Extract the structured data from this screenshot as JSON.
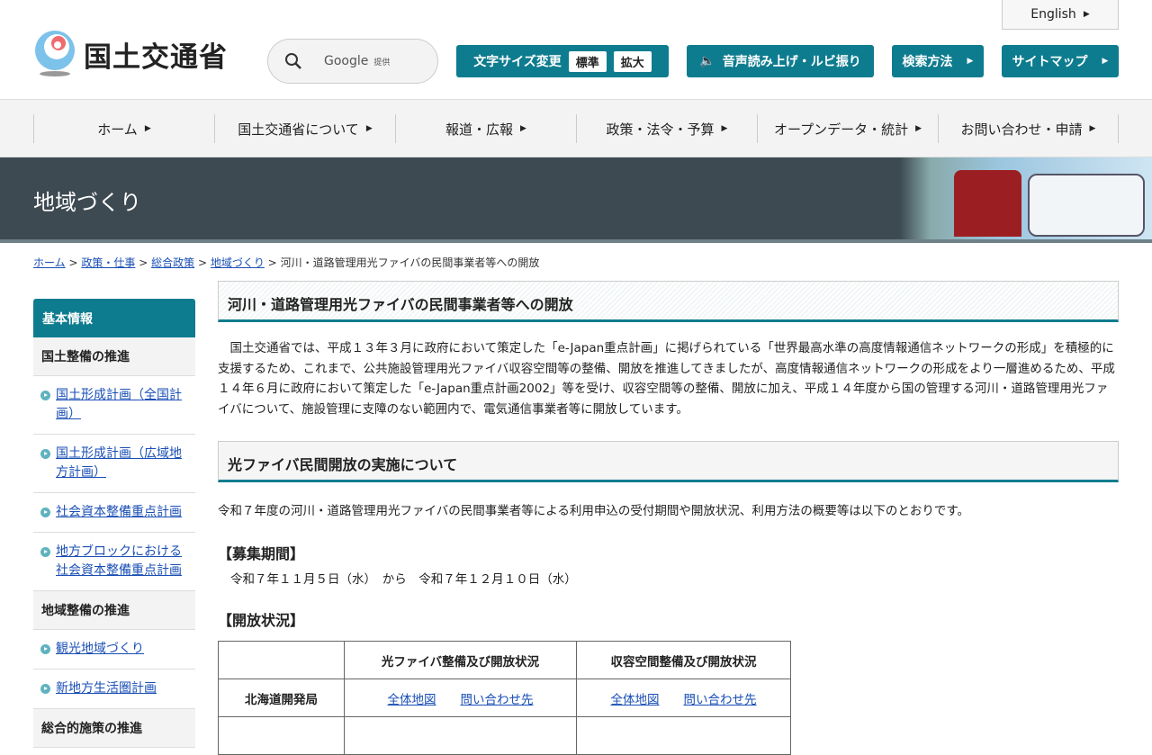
{
  "header": {
    "logo_text": "国土交通省",
    "search_label": "Google",
    "search_suffix": "提供",
    "english": "English",
    "font_size_label": "文字サイズ変更",
    "font_standard": "標準",
    "font_large": "拡大",
    "speech": "音声読み上げ・ルビ振り",
    "search_method": "検索方法",
    "sitemap": "サイトマップ"
  },
  "nav": [
    "ホーム",
    "国土交通省について",
    "報道・広報",
    "政策・法令・予算",
    "オープンデータ・統計",
    "お問い合わせ・申請"
  ],
  "banner": {
    "title": "地域づくり"
  },
  "breadcrumb": {
    "links": [
      "ホーム",
      "政策・仕事",
      "総合政策",
      "地域づくり"
    ],
    "current": "河川・道路管理用光ファイバの民間事業者等への開放",
    "sep": ">"
  },
  "sidebar": {
    "head": "基本情報",
    "sec1": "国土整備の推進",
    "links1": [
      "国土形成計画（全国計画）",
      "国土形成計画（広域地方計画）",
      "社会資本整備重点計画",
      "地方ブロックにおける社会資本整備重点計画"
    ],
    "sec2": "地域整備の推進",
    "links2": [
      "観光地域づくり",
      "新地方生活圏計画"
    ],
    "sec3": "総合的施策の推進"
  },
  "main": {
    "title": "河川・道路管理用光ファイバの民間事業者等への開放",
    "intro": "国土交通省では、平成１３年３月に政府において策定した「e-Japan重点計画」に掲げられている「世界最高水準の高度情報通信ネットワークの形成」を積極的に支援するため、これまで、公共施設管理用光ファイバ収容空間等の整備、開放を推進してきましたが、高度情報通信ネットワークの形成をより一層進めるため、平成１４年６月に政府において策定した「e-Japan重点計画2002」等を受け、収容空間等の整備、開放に加え、平成１４年度から国の管理する河川・道路管理用光ファイバについて、施設管理に支障のない範囲内で、電気通信事業者等に開放しています。",
    "section_title": "光ファイバ民間開放の実施について",
    "section_text": "令和７年度の河川・道路管理用光ファイバの民間事業者等による利用申込の受付期間や開放状況、利用方法の概要等は以下のとおりです。",
    "period_head": "【募集期間】",
    "period_text": "令和７年１１月５日（水）　から　令和７年１２月１０日（水）",
    "status_head": "【開放状況】",
    "table": {
      "headers": [
        "",
        "光ファイバ整備及び開放状況",
        "収容空間整備及び開放状況"
      ],
      "rows": [
        {
          "name": "北海道開発局",
          "links": [
            "全体地図",
            "問い合わせ先",
            "全体地図",
            "問い合わせ先"
          ]
        }
      ]
    }
  }
}
